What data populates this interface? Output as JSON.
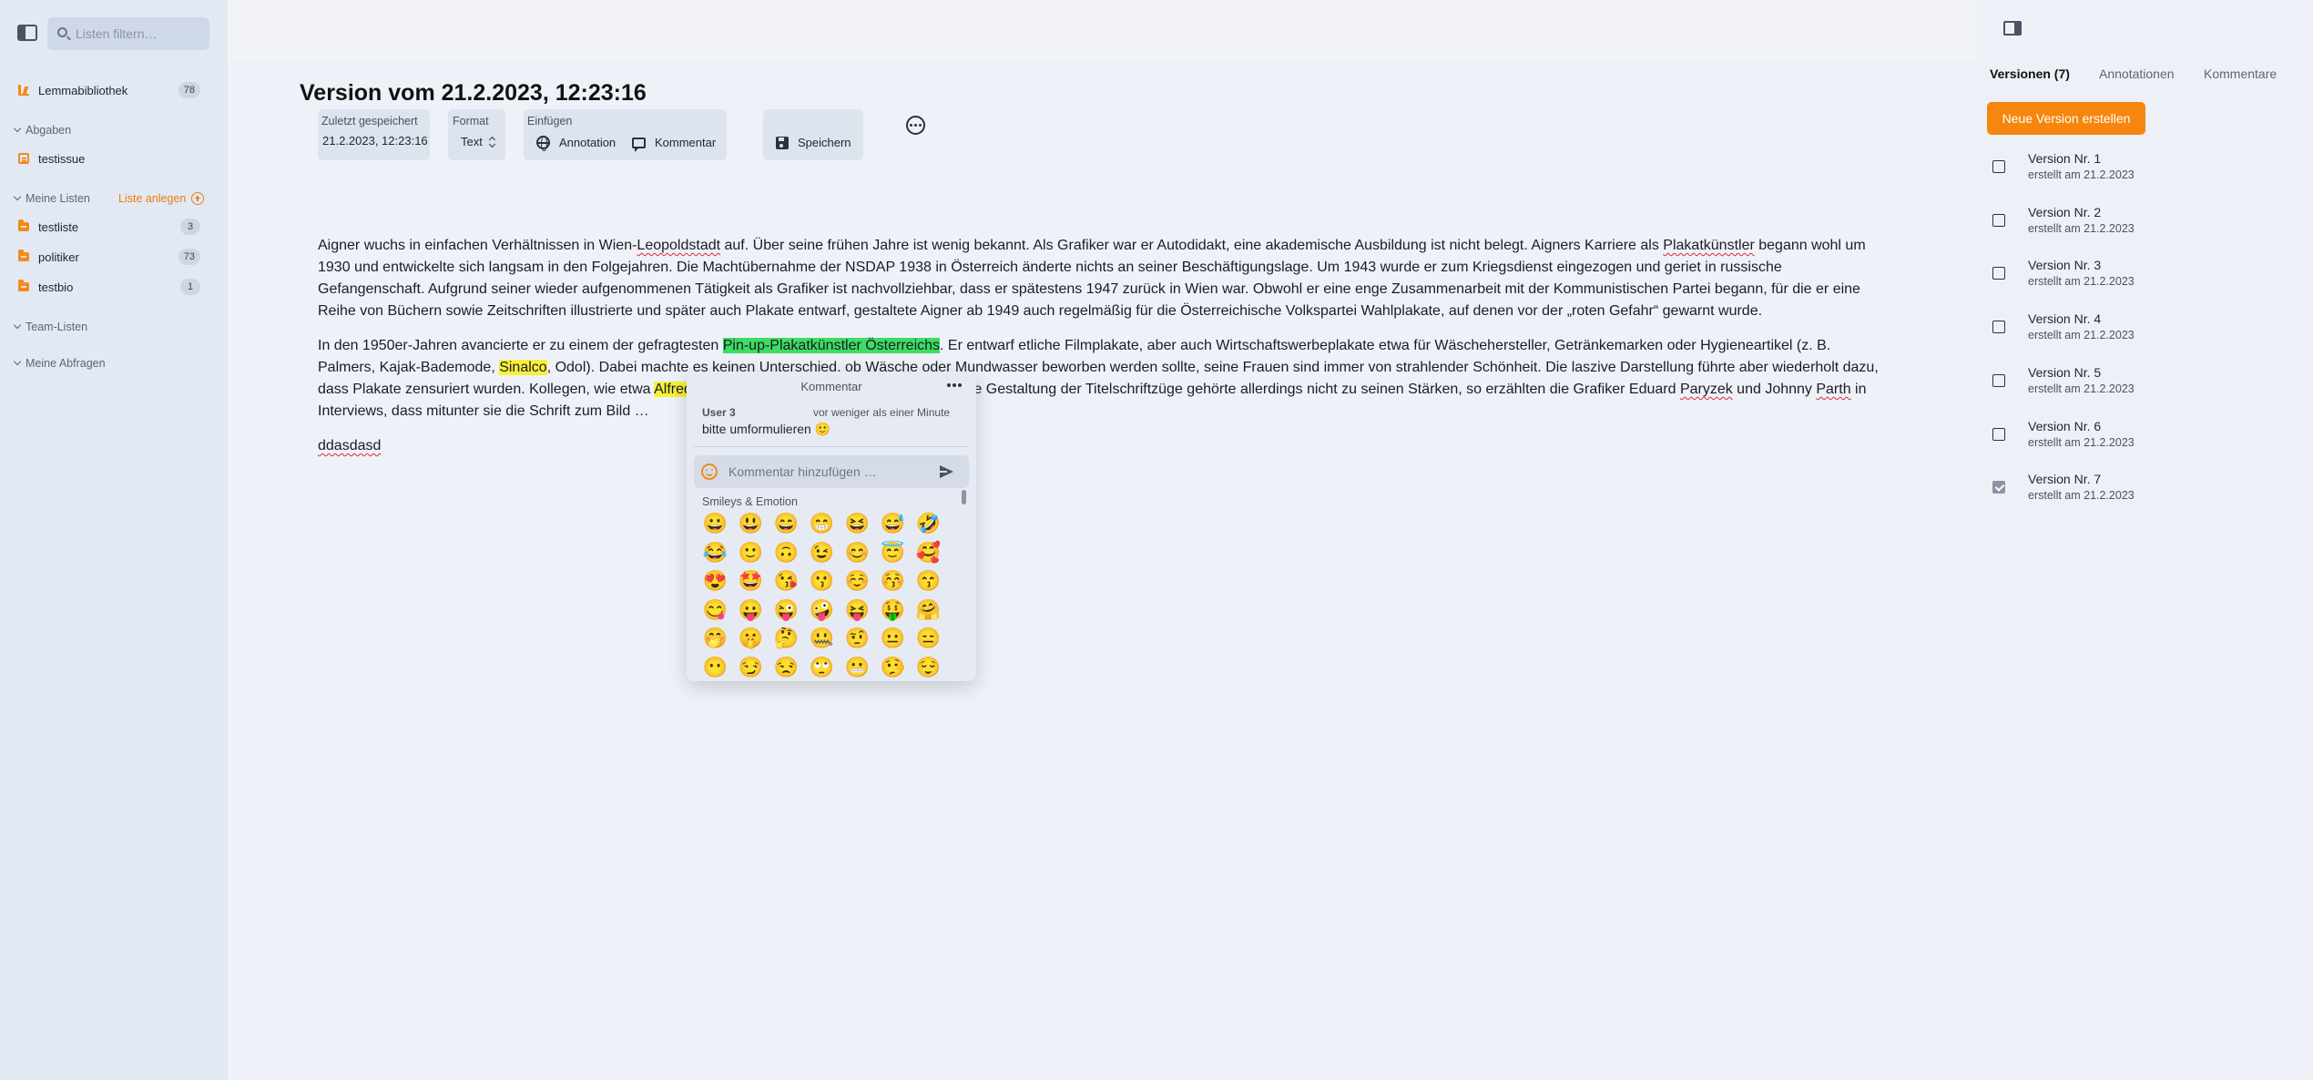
{
  "sidebar": {
    "filter_placeholder": "Listen filtern…",
    "library": {
      "label": "Lemmabibliothek",
      "count": "78"
    },
    "abgaben": {
      "label": "Abgaben",
      "items": [
        {
          "label": "testissue"
        }
      ]
    },
    "meine_listen": {
      "label": "Meine Listen",
      "add_label": "Liste anlegen",
      "items": [
        {
          "label": "testliste",
          "count": "3"
        },
        {
          "label": "politiker",
          "count": "73"
        },
        {
          "label": "testbio",
          "count": "1"
        }
      ]
    },
    "team_listen": {
      "label": "Team-Listen"
    },
    "meine_abfragen": {
      "label": "Meine Abfragen"
    }
  },
  "document": {
    "title": "Version vom 21.2.2023, 12:23:16",
    "toolbar": {
      "saved_label": "Zuletzt gespeichert",
      "saved_value": "21.2.2023, 12:23:16",
      "format_label": "Format",
      "format_value": "Text",
      "insert_label": "Einfügen",
      "annotation_label": "Annotation",
      "comment_label": "Kommentar",
      "save_label": "Speichern"
    },
    "p1": {
      "s1": "Aigner wuchs in einfachen Verhältnissen in Wien-",
      "w1": "Leopoldstadt",
      "s2": " auf. Über seine frühen Jahre ist wenig bekannt. Als Grafiker war er Autodidakt, eine akademische Ausbildung ist nicht belegt. Aigners Karriere als ",
      "w2": "Plakatkünstler",
      "s3": " begann wohl um 1930 und entwickelte sich langsam in den Folgejahren. Die Machtübernahme der NSDAP 1938 in Österreich änderte nichts an seiner Beschäftigungslage. Um 1943 wurde er zum Kriegsdienst eingezogen und geriet in russische Gefangenschaft. Aufgrund seiner wieder aufgenommenen Tätigkeit als Grafiker ist nachvollziehbar, dass er spätestens 1947 zurück in Wien war. Obwohl er eine enge Zusammenarbeit mit der Kommunistischen Partei begann, für die er eine Reihe von Büchern sowie Zeitschriften illustrierte und später auch Plakate entwarf, gestaltete Aigner ab 1949 auch regelmäßig für die Österreichische Volkspartei Wahlplakate, auf denen vor der „roten Gefahr“ gewarnt wurde."
    },
    "p2": {
      "s1": "In den 1950er-Jahren avancierte er zu einem der gefragtesten ",
      "hl1": "Pin-up-Plakatkünstler Österreichs",
      "s2": ". Er entwarf etliche Filmplakate, aber auch Wirtschaftswerbeplakate etwa für Wäschehersteller, Getränkemarken oder Hygieneartikel (z. B. Palmers, Kajak-Bademode, ",
      "hl2": "Sinalco",
      "s3": ", Odol). Dabei machte es keinen Unterschied, ob Wäsche oder Mundwasser beworben werden sollte, seine Frauen sind immer von strahlender Schönheit. Die laszive Darstellung führte aber wiederholt dazu, dass Plakate zensuriert wurden. Kollegen, wie etwa ",
      "hl3": "Alfred",
      "s4": " …, schätzten seine Arbeiten als elegant. Die Gestaltung der Titelschriftzüge gehörte allerdings nicht zu seinen Stärken, so erzählten die Grafiker Eduard ",
      "w3": "Paryzek",
      "s5": " und Johnny ",
      "w4": "Parth",
      "s6": " in Interviews, dass mitunter sie die Schrift zum Bild …"
    },
    "p3": "ddasdasd"
  },
  "comment_popup": {
    "title": "Kommentar",
    "user": "User 3",
    "time": "vor weniger als einer Minute",
    "text": "bitte umformulieren 🙂",
    "input_placeholder": "Kommentar hinzufügen …",
    "emoji_section": "Smileys & Emotion",
    "emojis": [
      "😀",
      "😃",
      "😄",
      "😁",
      "😆",
      "😅",
      "🤣",
      "😂",
      "🙂",
      "🙃",
      "😉",
      "😊",
      "😇",
      "🥰",
      "😍",
      "🤩",
      "😘",
      "😗",
      "☺️",
      "😚",
      "😙",
      "😋",
      "😛",
      "😜",
      "🤪",
      "😝",
      "🤑",
      "🤗",
      "🤭",
      "🤫",
      "🤔",
      "🤐",
      "🤨",
      "😐",
      "😑",
      "😶",
      "😏",
      "😒",
      "🙄",
      "😬",
      "🤥",
      "😌"
    ]
  },
  "right_panel": {
    "tabs": [
      {
        "label": "Versionen (7)"
      },
      {
        "label": "Annotationen"
      },
      {
        "label": "Kommentare"
      }
    ],
    "new_version_label": "Neue Version erstellen",
    "versions": [
      {
        "title": "Version Nr. 1",
        "date": "erstellt am 21.2.2023",
        "checked": false
      },
      {
        "title": "Version Nr. 2",
        "date": "erstellt am 21.2.2023",
        "checked": false
      },
      {
        "title": "Version Nr. 3",
        "date": "erstellt am 21.2.2023",
        "checked": false
      },
      {
        "title": "Version Nr. 4",
        "date": "erstellt am 21.2.2023",
        "checked": false
      },
      {
        "title": "Version Nr. 5",
        "date": "erstellt am 21.2.2023",
        "checked": false
      },
      {
        "title": "Version Nr. 6",
        "date": "erstellt am 21.2.2023",
        "checked": false
      },
      {
        "title": "Version Nr. 7",
        "date": "erstellt am 21.2.2023",
        "checked": true
      }
    ]
  },
  "colors": {
    "accent": "#f7860f",
    "highlight_green": "#3ddc63",
    "highlight_yellow": "#f7f03a"
  }
}
